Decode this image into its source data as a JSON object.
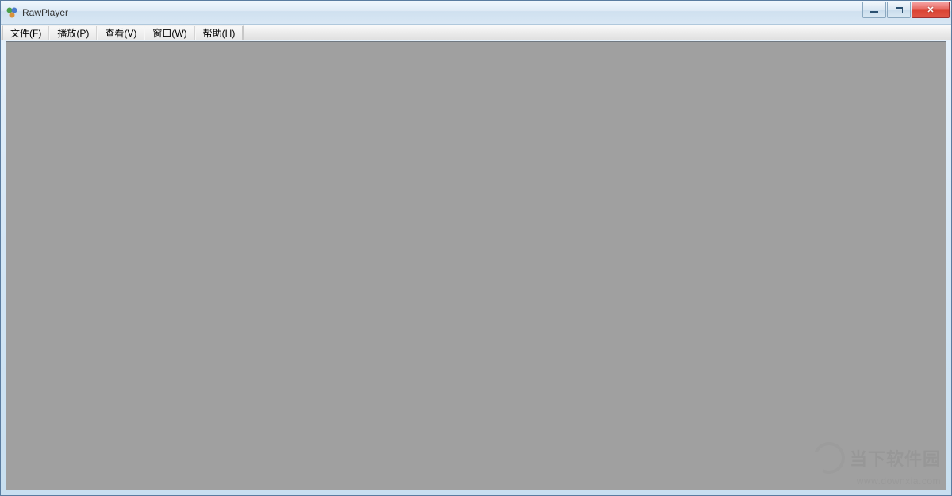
{
  "window": {
    "title": "RawPlayer"
  },
  "menu": {
    "items": [
      {
        "label": "文件(F)"
      },
      {
        "label": "播放(P)"
      },
      {
        "label": "查看(V)"
      },
      {
        "label": "窗口(W)"
      },
      {
        "label": "帮助(H)"
      }
    ]
  },
  "watermark": {
    "text": "当下软件园",
    "url": "www.downxia.com"
  }
}
